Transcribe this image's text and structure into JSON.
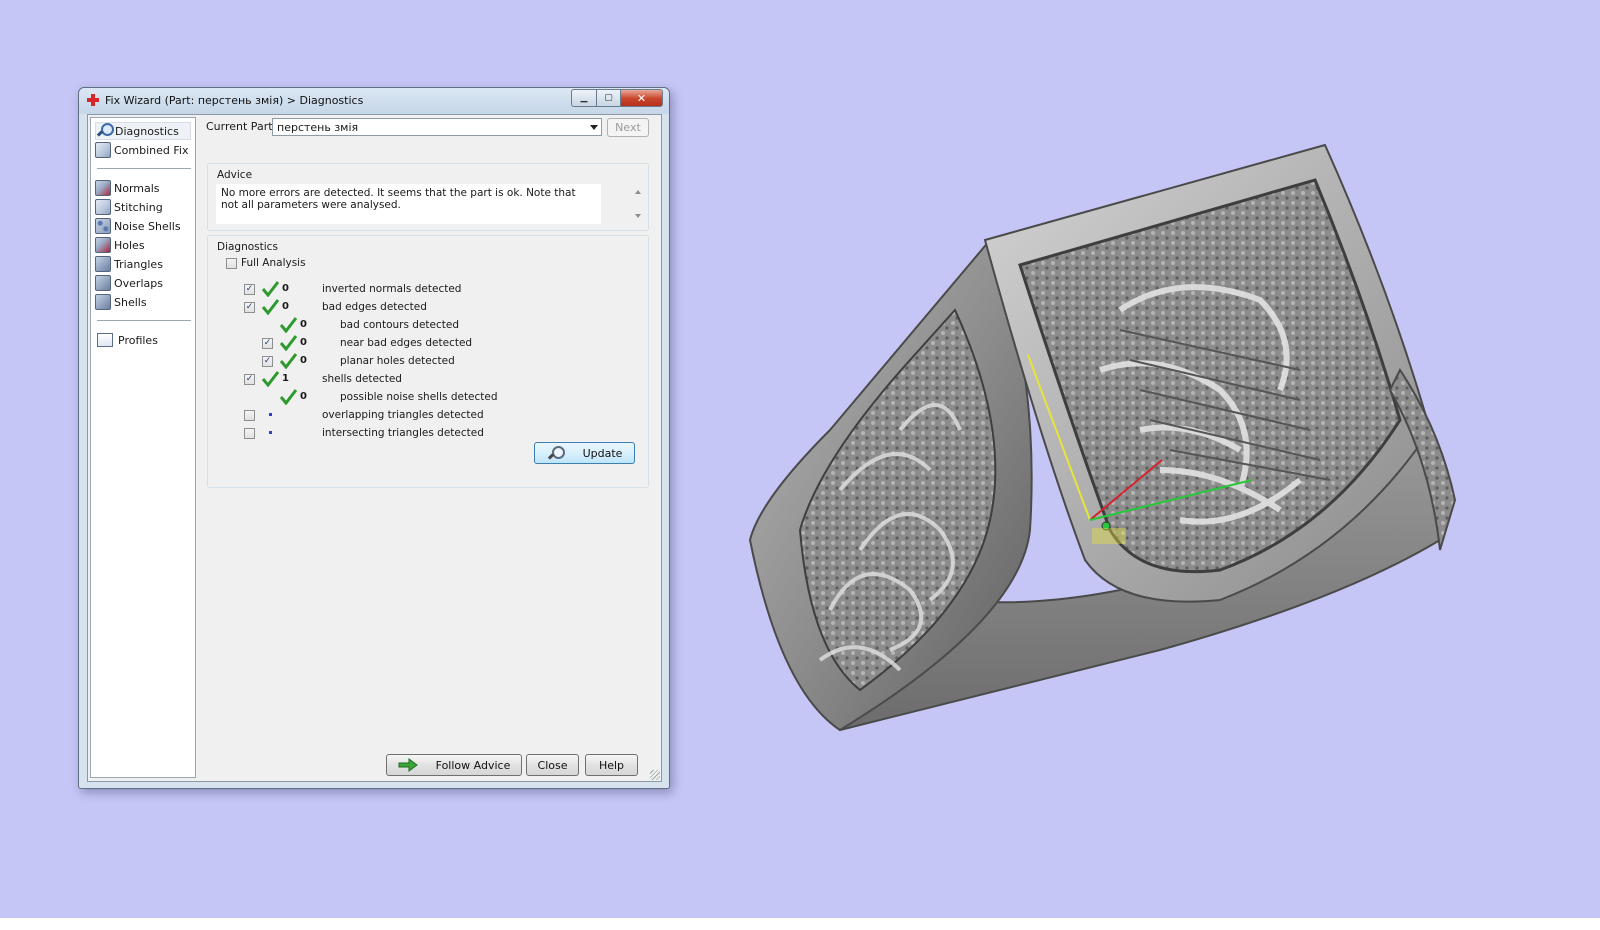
{
  "window": {
    "title": "Fix Wizard (Part: перстень змія) > Diagnostics"
  },
  "sidebar": {
    "items": [
      {
        "label": "Diagnostics"
      },
      {
        "label": "Combined Fix"
      },
      {
        "label": "Normals"
      },
      {
        "label": "Stitching"
      },
      {
        "label": "Noise Shells"
      },
      {
        "label": "Holes"
      },
      {
        "label": "Triangles"
      },
      {
        "label": "Overlaps"
      },
      {
        "label": "Shells"
      },
      {
        "label": "Profiles"
      }
    ]
  },
  "current_part": {
    "label": "Current Part:",
    "value": "перстень змія",
    "next_label": "Next"
  },
  "advice": {
    "title": "Advice",
    "text": "No more errors are detected. It seems that the part is ok. Note that not all parameters were analysed."
  },
  "diagnostics": {
    "title": "Diagnostics",
    "full_analysis_label": "Full Analysis",
    "rows": [
      {
        "count": "0",
        "label": "inverted normals detected"
      },
      {
        "count": "0",
        "label": "bad edges detected"
      },
      {
        "count": "0",
        "label": "bad contours detected"
      },
      {
        "count": "0",
        "label": "near bad edges detected"
      },
      {
        "count": "0",
        "label": "planar holes detected"
      },
      {
        "count": "1",
        "label": "shells detected"
      },
      {
        "count": "0",
        "label": "possible noise shells detected"
      },
      {
        "count": "",
        "label": "overlapping triangles detected"
      },
      {
        "count": "",
        "label": "intersecting triangles detected"
      }
    ],
    "update_label": "Update"
  },
  "footer": {
    "follow_advice_label": "Follow Advice",
    "close_label": "Close",
    "help_label": "Help"
  },
  "colors": {
    "desktop": "#c6c6f6",
    "check_green": "#2e9a2e",
    "axis_x": "#d8202a",
    "axis_y": "#e7e43a",
    "axis_z": "#28c83a"
  },
  "viewport": {
    "object": "ring model with serpent relief and celtic knot pattern"
  }
}
